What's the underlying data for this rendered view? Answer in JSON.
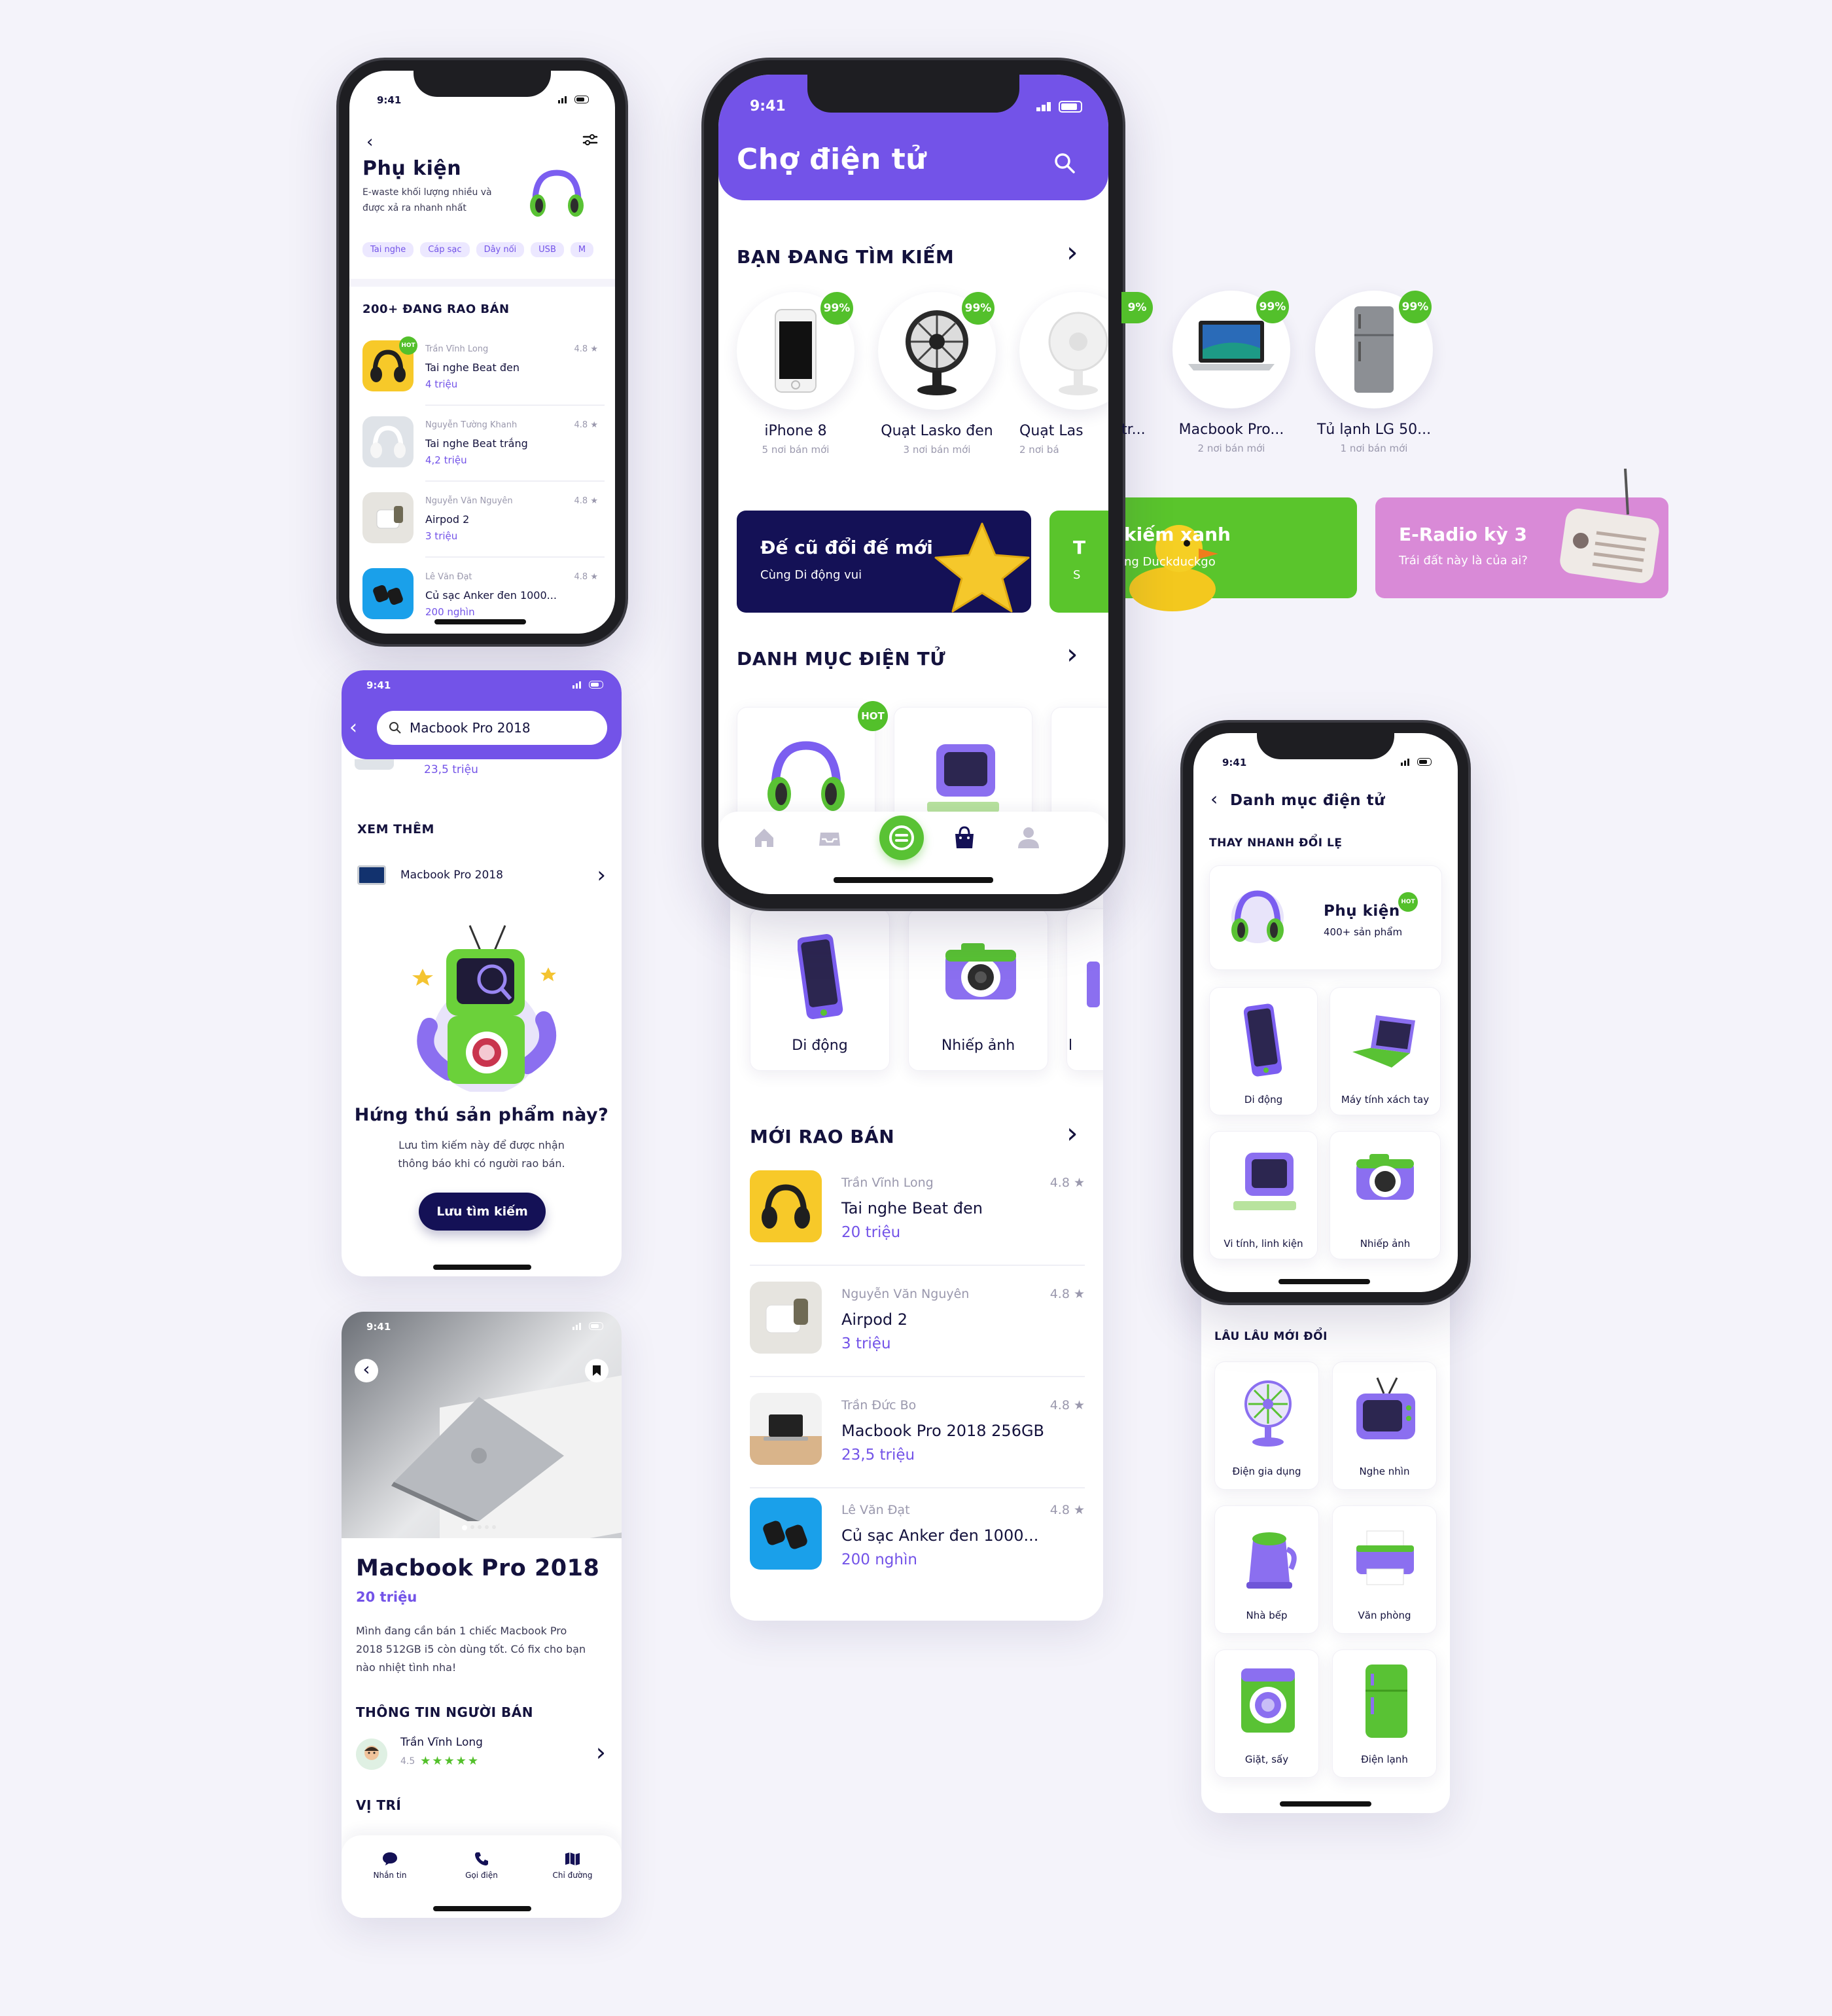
{
  "status_time": "9:41",
  "phone_accessory": {
    "title": "Phụ kiện",
    "desc_line1": "E-waste khối lượng nhiều và",
    "desc_line2": "được xả ra nhanh nhất",
    "chips": [
      "Tai nghe",
      "Cáp sạc",
      "Dây nối",
      "USB",
      "M"
    ],
    "section": "200+ ĐANG RAO BÁN",
    "hot": "HOT",
    "items": [
      {
        "seller": "Trần Vĩnh Long",
        "rating": "4.8 ★",
        "name": "Tai nghe Beat đen",
        "price": "4 triệu"
      },
      {
        "seller": "Nguyễn Tường Khanh",
        "rating": "4.8 ★",
        "name": "Tai nghe Beat trắng",
        "price": "4,2 triệu"
      },
      {
        "seller": "Nguyễn Văn Nguyên",
        "rating": "4.8 ★",
        "name": "Airpod 2",
        "price": "3 triệu"
      },
      {
        "seller": "Lê Văn Đạt",
        "rating": "4.8 ★",
        "name": "Củ sạc Anker đen 1000...",
        "price": "200 nghìn"
      }
    ]
  },
  "phone_main": {
    "title": "Chợ điện tử",
    "section_search": "BẠN ĐANG TÌM KIẾM",
    "recent": [
      {
        "name": "iPhone 8",
        "sub": "5 nơi bán mới",
        "pct": "99%"
      },
      {
        "name": "Quạt Lasko đen",
        "sub": "3 nơi bán mới",
        "pct": "99%"
      },
      {
        "name": "Quạt Las",
        "name_tail": "tr...",
        "sub": "2 nơi bá",
        "pct": "9%"
      },
      {
        "name": "Macbook Pro...",
        "sub": "2 nơi bán mới",
        "pct": "99%"
      },
      {
        "name": "Tủ lạnh LG 50...",
        "sub": "1 nơi bán mới",
        "pct": "99%"
      }
    ],
    "banners": [
      {
        "title": "Đế cũ đổi đế mới",
        "sub": "Cùng Di động vui",
        "color": "#141156"
      },
      {
        "title_a": "T",
        "title_b": "kiếm xanh",
        "sub_a": "S",
        "sub_b": "ng Duckduckgo",
        "color": "#5ac52c"
      },
      {
        "title": "E-Radio kỳ 3",
        "sub": "Trái đất này là của ai?",
        "color": "#d98ad7"
      }
    ],
    "section_category": "DANH MỤC ĐIỆN TỬ",
    "hot": "HOT",
    "categories": [
      "Di động",
      "Nhiếp ảnh",
      "l"
    ],
    "section_new": "MỚI RAO BÁN",
    "new_items": [
      {
        "seller": "Trần Vĩnh Long",
        "rating": "4.8 ★",
        "name": "Tai nghe Beat đen",
        "price": "20 triệu"
      },
      {
        "seller": "Nguyễn Văn Nguyên",
        "rating": "4.8 ★",
        "name": "Airpod 2",
        "price": "3 triệu"
      },
      {
        "seller": "Trần Đức Bo",
        "rating": "4.8 ★",
        "name": "Macbook Pro 2018 256GB",
        "price": "23,5 triệu"
      },
      {
        "seller": "Lê Văn Đạt",
        "rating": "4.8 ★",
        "name": "Củ sạc Anker đen 1000...",
        "price": "200 nghìn"
      }
    ]
  },
  "phone_search": {
    "query": "Macbook Pro 2018",
    "prev_price": "23,5 triệu",
    "section": "XEM THÊM",
    "more_item": "Macbook Pro 2018",
    "title": "Hứng thú sản phẩm này?",
    "desc_line1": "Lưu tìm kiếm này để được nhận",
    "desc_line2": "thông báo khi có người rao bán.",
    "button": "Lưu tìm kiếm"
  },
  "phone_detail": {
    "title": "Macbook Pro 2018",
    "price": "20 triệu",
    "desc_line1": "Mình đang cần bán 1 chiếc Macbook Pro",
    "desc_line2": "2018 512GB i5 còn dùng tốt. Có fix cho bạn",
    "desc_line3": "nào nhiệt tình nha!",
    "seller_section": "THÔNG TIN NGƯỜI BÁN",
    "seller_name": "Trần Vĩnh Long",
    "seller_rating": "4.5",
    "location_section": "VỊ TRÍ",
    "actions": [
      "Nhắn tin",
      "Gọi điện",
      "Chỉ đường"
    ]
  },
  "phone_category": {
    "title": "Danh mục điện tử",
    "section_quick": "THAY NHANH ĐỔI LẸ",
    "featured_title": "Phụ kiện",
    "featured_sub": "400+ sản phẩm",
    "hot": "HOT",
    "quick_items": [
      "Di động",
      "Máy tính xách tay",
      "Vi tính, linh kiện",
      "Nhiếp ảnh"
    ],
    "section_slow": "LÂU LÂU MỚI ĐỔI",
    "slow_items": [
      "Điện gia dụng",
      "Nghe nhìn",
      "Nhà bếp",
      "Văn phòng",
      "Giặt, sấy",
      "Điện lạnh"
    ]
  },
  "colors": {
    "accent": "#7353e8",
    "green": "#53c02b",
    "navy": "#141156",
    "pink": "#d98ad7"
  }
}
